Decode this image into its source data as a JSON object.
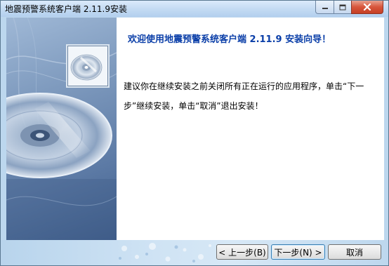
{
  "window": {
    "title": "地震预警系统客户端 2.11.9安装",
    "buttons": {
      "minimize": "minimize",
      "maximize": "maximize",
      "close": "close"
    }
  },
  "content": {
    "welcome": "欢迎使用地震预警系统客户端 2.11.9 安装向导！",
    "instruction": "建议你在继续安装之前关闭所有正在运行的应用程序，单击“下一步”继续安装，单击“取消”退出安装！"
  },
  "buttons": {
    "back": "< 上一步(B)",
    "next": "下一步(N) >",
    "cancel": "取消"
  },
  "colors": {
    "welcome_text": "#0a3ea8",
    "side_panel": "#5c7aa5",
    "close_button": "#c53f25"
  }
}
